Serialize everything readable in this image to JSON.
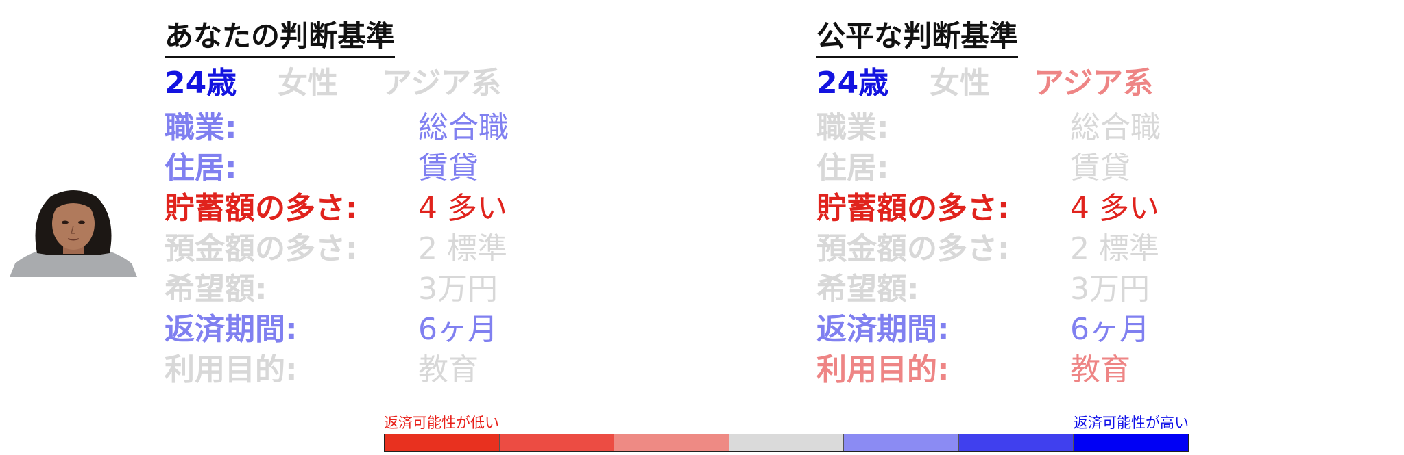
{
  "colors": {
    "blue_strong": "#1313e0",
    "blue_light": "#8080f0",
    "red_strong": "#e0231d",
    "red_light": "#ee8585",
    "gray": "#d8d8d8"
  },
  "left_panel": {
    "title": "あなたの判断基準",
    "demographics": {
      "age": "24歳",
      "age_color": "#1313e0",
      "gender": "女性",
      "gender_color": "#d8d8d8",
      "ethnicity": "アジア系",
      "ethnicity_color": "#d8d8d8"
    },
    "rows": [
      {
        "label": "職業:",
        "value": "総合職",
        "color": "#8080f0"
      },
      {
        "label": "住居:",
        "value": "賃貸",
        "color": "#8080f0"
      },
      {
        "label": "貯蓄額の多さ:",
        "value": "4 多い",
        "color": "#e0231d"
      },
      {
        "label": "預金額の多さ:",
        "value": "2 標準",
        "color": "#d8d8d8"
      },
      {
        "label": "希望額:",
        "value": "3万円",
        "color": "#d8d8d8"
      },
      {
        "label": "返済期間:",
        "value": "6ヶ月",
        "color": "#8080f0"
      },
      {
        "label": "利用目的:",
        "value": "教育",
        "color": "#d8d8d8"
      }
    ]
  },
  "right_panel": {
    "title": "公平な判断基準",
    "demographics": {
      "age": "24歳",
      "age_color": "#1313e0",
      "gender": "女性",
      "gender_color": "#d8d8d8",
      "ethnicity": "アジア系",
      "ethnicity_color": "#ee8585"
    },
    "rows": [
      {
        "label": "職業:",
        "value": "総合職",
        "color": "#d8d8d8"
      },
      {
        "label": "住居:",
        "value": "賃貸",
        "color": "#d8d8d8"
      },
      {
        "label": "貯蓄額の多さ:",
        "value": "4 多い",
        "color": "#e0231d"
      },
      {
        "label": "預金額の多さ:",
        "value": "2 標準",
        "color": "#d8d8d8"
      },
      {
        "label": "希望額:",
        "value": "3万円",
        "color": "#d8d8d8"
      },
      {
        "label": "返済期間:",
        "value": "6ヶ月",
        "color": "#8080f0"
      },
      {
        "label": "利用目的:",
        "value": "教育",
        "color": "#ee8585"
      }
    ]
  },
  "legend": {
    "low_label": "返済可能性が低い",
    "high_label": "返済可能性が高い",
    "segments": [
      "#e8311f",
      "#ec4c43",
      "#ee8a84",
      "#dadada",
      "#8b8bf3",
      "#4040ee",
      "#0000f5"
    ]
  }
}
